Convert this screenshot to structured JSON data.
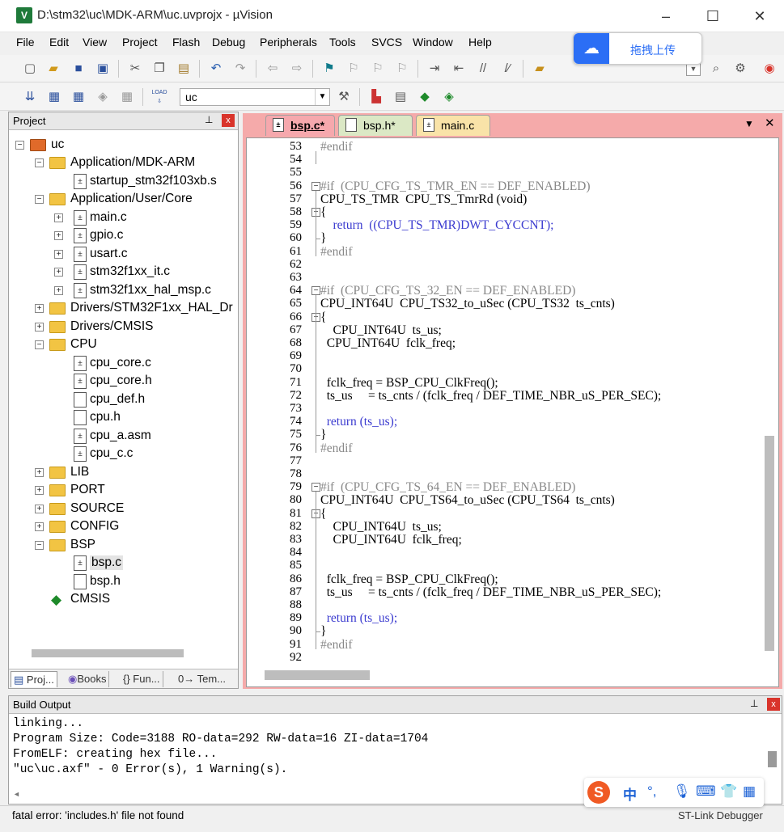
{
  "window": {
    "title": "D:\\stm32\\uc\\MDK-ARM\\uc.uvprojx - µVision",
    "icon_text": "V",
    "controls": {
      "minimize": "–",
      "maximize": "☐",
      "close": "✕"
    }
  },
  "menu": [
    "File",
    "Edit",
    "View",
    "Project",
    "Flash",
    "Debug",
    "Peripherals",
    "Tools",
    "SVCS",
    "Window",
    "Help"
  ],
  "upload_overlay": {
    "label": "拖拽上传"
  },
  "toolbar2": {
    "target": "uc",
    "load_label": "LOAD"
  },
  "project_panel": {
    "title": "Project",
    "pin": "⊥",
    "close": "x",
    "tree": [
      {
        "label": "uc"
      },
      {
        "label": "Application/MDK-ARM"
      },
      {
        "label": "startup_stm32f103xb.s"
      },
      {
        "label": "Application/User/Core"
      },
      {
        "label": "main.c"
      },
      {
        "label": "gpio.c"
      },
      {
        "label": "usart.c"
      },
      {
        "label": "stm32f1xx_it.c"
      },
      {
        "label": "stm32f1xx_hal_msp.c"
      },
      {
        "label": "Drivers/STM32F1xx_HAL_Dr"
      },
      {
        "label": "Drivers/CMSIS"
      },
      {
        "label": "CPU"
      },
      {
        "label": "cpu_core.c"
      },
      {
        "label": "cpu_core.h"
      },
      {
        "label": "cpu_def.h"
      },
      {
        "label": "cpu.h"
      },
      {
        "label": "cpu_a.asm"
      },
      {
        "label": "cpu_c.c"
      },
      {
        "label": "LIB"
      },
      {
        "label": "PORT"
      },
      {
        "label": "SOURCE"
      },
      {
        "label": "CONFIG"
      },
      {
        "label": "BSP"
      },
      {
        "label": "bsp.c"
      },
      {
        "label": "bsp.h"
      },
      {
        "label": "CMSIS"
      }
    ],
    "tabs": [
      "Proj...",
      "Books",
      "{} Fun...",
      "0→ Tem..."
    ]
  },
  "editor": {
    "tabs": [
      {
        "label": "bsp.c*"
      },
      {
        "label": "bsp.h*"
      },
      {
        "label": "main.c"
      }
    ],
    "tabbar_controls": {
      "dropdown": "▼",
      "close": "✕"
    },
    "lines": [
      {
        "n": "53",
        "text": "#endif"
      },
      {
        "n": "54",
        "text": ""
      },
      {
        "n": "55",
        "text": ""
      },
      {
        "n": "56",
        "text": "#if  (CPU_CFG_TS_TMR_EN == DEF_ENABLED)"
      },
      {
        "n": "57",
        "text": "CPU_TS_TMR  CPU_TS_TmrRd (void)"
      },
      {
        "n": "58",
        "text": "{"
      },
      {
        "n": "59",
        "text": "    return  ((CPU_TS_TMR)DWT_CYCCNT);"
      },
      {
        "n": "60",
        "text": "}"
      },
      {
        "n": "61",
        "text": "#endif"
      },
      {
        "n": "62",
        "text": ""
      },
      {
        "n": "63",
        "text": ""
      },
      {
        "n": "64",
        "text": "#if  (CPU_CFG_TS_32_EN == DEF_ENABLED)"
      },
      {
        "n": "65",
        "text": "CPU_INT64U  CPU_TS32_to_uSec (CPU_TS32  ts_cnts)"
      },
      {
        "n": "66",
        "text": "{"
      },
      {
        "n": "67",
        "text": "    CPU_INT64U  ts_us;"
      },
      {
        "n": "68",
        "text": "  CPU_INT64U  fclk_freq;"
      },
      {
        "n": "69",
        "text": ""
      },
      {
        "n": "70",
        "text": ""
      },
      {
        "n": "71",
        "text": "  fclk_freq = BSP_CPU_ClkFreq();"
      },
      {
        "n": "72",
        "text": "  ts_us     = ts_cnts / (fclk_freq / DEF_TIME_NBR_uS_PER_SEC);"
      },
      {
        "n": "73",
        "text": ""
      },
      {
        "n": "74",
        "text": "  return (ts_us);"
      },
      {
        "n": "75",
        "text": "}"
      },
      {
        "n": "76",
        "text": "#endif"
      },
      {
        "n": "77",
        "text": ""
      },
      {
        "n": "78",
        "text": ""
      },
      {
        "n": "79",
        "text": "#if  (CPU_CFG_TS_64_EN == DEF_ENABLED)"
      },
      {
        "n": "80",
        "text": "CPU_INT64U  CPU_TS64_to_uSec (CPU_TS64  ts_cnts)"
      },
      {
        "n": "81",
        "text": "{"
      },
      {
        "n": "82",
        "text": "    CPU_INT64U  ts_us;"
      },
      {
        "n": "83",
        "text": "    CPU_INT64U  fclk_freq;"
      },
      {
        "n": "84",
        "text": ""
      },
      {
        "n": "85",
        "text": ""
      },
      {
        "n": "86",
        "text": "  fclk_freq = BSP_CPU_ClkFreq();"
      },
      {
        "n": "87",
        "text": "  ts_us     = ts_cnts / (fclk_freq / DEF_TIME_NBR_uS_PER_SEC);"
      },
      {
        "n": "88",
        "text": ""
      },
      {
        "n": "89",
        "text": "  return (ts_us);"
      },
      {
        "n": "90",
        "text": "}"
      },
      {
        "n": "91",
        "text": "#endif"
      },
      {
        "n": "92",
        "text": ""
      }
    ]
  },
  "build_output": {
    "title": "Build Output",
    "pin": "⊥",
    "close": "x",
    "lines": [
      "linking...",
      "Program Size: Code=3188 RO-data=292 RW-data=16 ZI-data=1704",
      "FromELF: creating hex file...",
      "\"uc\\uc.axf\" - 0 Error(s), 1 Warning(s)."
    ]
  },
  "status": {
    "message": "fatal error: 'includes.h' file not found",
    "right": "ST-Link Debugger"
  },
  "ime": {
    "logo": "S",
    "mode": "中"
  },
  "colors": {
    "editor_frame": "#f5aaaa",
    "tab_active": "#f6a8ad",
    "tab_h": "#dbe8c5",
    "tab_main": "#f9e3a8",
    "keyword": "#3a3acf",
    "preprocessor": "#888888",
    "close_red": "#d9342b"
  }
}
